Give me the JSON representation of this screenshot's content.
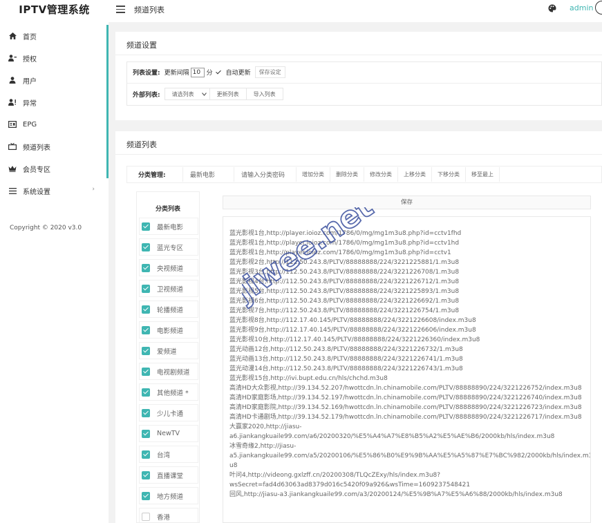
{
  "app": {
    "title": "IPTV管理系统",
    "copyright": "Copyright © 2020 v3.0"
  },
  "sidebar": {
    "items": [
      {
        "label": "首页",
        "icon": "home-icon"
      },
      {
        "label": "授权",
        "icon": "user-key-icon"
      },
      {
        "label": "用户",
        "icon": "user-icon"
      },
      {
        "label": "异常",
        "icon": "user-warning-icon"
      },
      {
        "label": "EPG",
        "icon": "tv-guide-icon"
      },
      {
        "label": "频道列表",
        "icon": "tv-icon"
      },
      {
        "label": "会员专区",
        "icon": "crown-icon"
      },
      {
        "label": "系统设置",
        "icon": "menu-lines-icon"
      }
    ]
  },
  "header": {
    "title": "频道列表",
    "user": "admin"
  },
  "channel_settings": {
    "title": "频道设置",
    "list_settings_label": "列表设置:",
    "interval_label": "更新间隔",
    "interval_value": "10",
    "interval_unit": "分",
    "auto_update_label": "自动更新",
    "auto_update_checked": true,
    "save_settings_label": "保存设定",
    "external_list_label": "外部列表:",
    "select_placeholder": "请选列表",
    "update_list_label": "更新列表",
    "import_list_label": "导入列表"
  },
  "channel_list": {
    "title": "频道列表",
    "category_manage_label": "分类管理:",
    "category_name_value": "最新电影",
    "category_password_placeholder": "请输入分类密码",
    "buttons": [
      "增加分类",
      "删除分类",
      "修改分类",
      "上移分类",
      "下移分类",
      "移至最上"
    ],
    "category_list_title": "分类列表",
    "categories": [
      {
        "label": "最新电影",
        "checked": true
      },
      {
        "label": "蓝光专区",
        "checked": true
      },
      {
        "label": "央视频道",
        "checked": true
      },
      {
        "label": "卫视频道",
        "checked": true
      },
      {
        "label": "轮播频道",
        "checked": true
      },
      {
        "label": "电影频道",
        "checked": true
      },
      {
        "label": "爱频道",
        "checked": true
      },
      {
        "label": "电视剧频道",
        "checked": true
      },
      {
        "label": "其他频道 *",
        "checked": true
      },
      {
        "label": "少儿卡通",
        "checked": true
      },
      {
        "label": "NewTV",
        "checked": true
      },
      {
        "label": "台湾",
        "checked": true
      },
      {
        "label": "直播课堂",
        "checked": true
      },
      {
        "label": "地方频道",
        "checked": true
      },
      {
        "label": "香港",
        "checked": false
      }
    ],
    "save_label": "保存",
    "channel_text": [
      "蓝光影视1台,http://player.ioioz.com/1786/0/mg/mg1m3u8.php?id=cctv1fhd",
      "蓝光影视1台,http://player.ioioz.com/1786/0/mg/mg1m3u8.php?id=cctv1hd",
      "蓝光影视1台,http://player.ioioz.com/1786/0/mg/mg1m3u8.php?id=cctv1",
      "蓝光影视2台,http://112.50.243.8/PLTV/88888888/224/3221225881/1.m3u8",
      "蓝光影视3台,http://112.50.243.8/PLTV/88888888/224/3221226708/1.m3u8",
      "蓝光影视4台,http://112.50.243.8/PLTV/88888888/224/3221226712/1.m3u8",
      "蓝光影视5台,http://112.50.243.8/PLTV/88888888/224/3221225893/1.m3u8",
      "蓝光影视6台,http://112.50.243.8/PLTV/88888888/224/3221226692/1.m3u8",
      "蓝光影视7台,http://112.50.243.8/PLTV/88888888/224/3221226754/1.m3u8",
      "蓝光影视8台,http://112.17.40.145/PLTV/88888888/224/3221226608/index.m3u8",
      "蓝光影视9台,http://112.17.40.145/PLTV/88888888/224/3221226606/index.m3u8",
      "蓝光影视10台,http://112.17.40.145/PLTV/88888888/224/3221226360/index.m3u8",
      "蓝光动画12台,http://112.50.243.8/PLTV/88888888/224/3221226732/1.m3u8",
      "蓝光动画13台,http://112.50.243.8/PLTV/88888888/224/3221226741/1.m3u8",
      "蓝光动漫14台,http://112.50.243.8/PLTV/88888888/224/3221226743/1.m3u8",
      "蓝光影视15台,http://ivi.bupt.edu.cn/hls/chchd.m3u8",
      "高清HD大众影视,http://39.134.52.207/hwottcdn.ln.chinamobile.com/PLTV/88888890/224/3221226752/index.m3u8",
      "高清HD家庭影场,http://39.134.52.197/hwottcdn.ln.chinamobile.com/PLTV/88888890/224/3221226740/index.m3u8",
      "高清HD家庭影院,http://39.134.52.169/hwottcdn.ln.chinamobile.com/PLTV/88888890/224/3221226723/index.m3u8",
      "高清HD卡通剧场,http://39.134.52.179/hwottcdn.ln.chinamobile.com/PLTV/88888890/224/3221226717/index.m3u8",
      "大赢家2020,http://jiasu-",
      "a6.jiankangkuaile99.com/a6/20200320/%E5%A4%A7%E8%B5%A2%E5%AE%B6/2000kb/hls/index.m3u8",
      "冰雪奇缘2,http://jiasu-",
      "a5.jiankangkuaile99.com/a5/20200106/%E5%86%B0%E9%9B%AA%E5%A5%87%E7%BC%982/2000kb/hls/index.m3",
      "u8",
      "叶问4,http://videong.gxlzff.cn/20200308/TLQcZExy/hls/index.m3u8?",
      "wsSecret=fad4d63063ad8379d016c5420f09a926&wsTime=1609237548421",
      "回风,http://jiasu-a3.jiankangkuaile99.com/a3/20200124/%E5%9B%A7%E5%A6%88/2000kb/hls/index.m3u8"
    ]
  },
  "watermark": {
    "text": "jiwee.net"
  },
  "colors": {
    "accent": "#3fb6b2",
    "watermark": "#3a4f9e"
  }
}
